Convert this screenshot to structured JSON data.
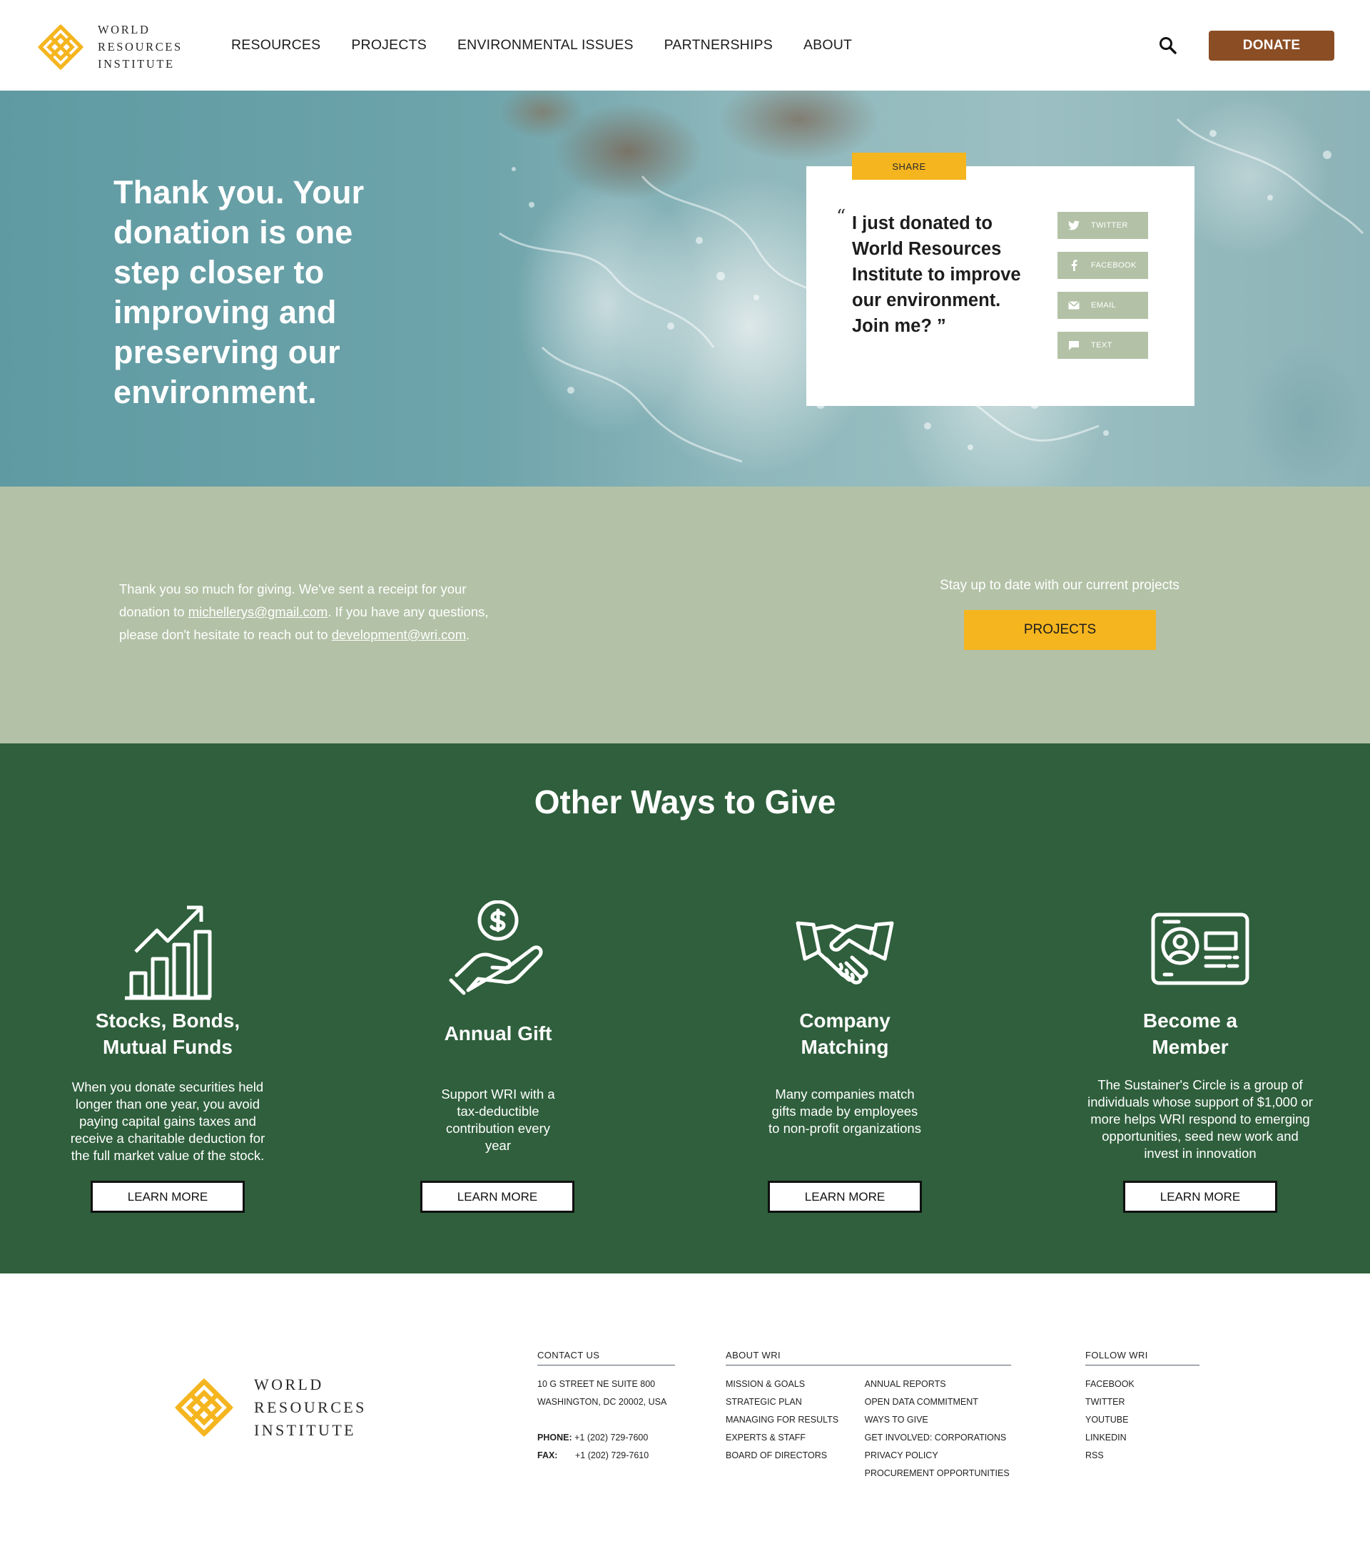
{
  "brand": {
    "line1": "World",
    "line2": "Resources",
    "line3": "Institute",
    "color_gold": "#f5b51f",
    "color_brown": "#8b4d24",
    "color_sage": "#b3c2a7",
    "color_green": "#2f5f3c"
  },
  "nav": {
    "items": [
      "RESOURCES",
      "PROJECTS",
      "ENVIRONMENTAL ISSUES",
      "PARTNERSHIPS",
      "ABOUT"
    ],
    "search_icon": "search-icon",
    "donate_label": "DONATE"
  },
  "hero": {
    "title": "Thank you. Your donation is one step closer to improving and preserving our environment.",
    "share_label": "SHARE",
    "quote": "I just donated to World Resources Institute to improve our environment. Join me?",
    "quote_open": "“",
    "quote_close": "”",
    "share_buttons": [
      {
        "label": "TWITTER",
        "icon": "twitter-icon"
      },
      {
        "label": "FACEBOOK",
        "icon": "facebook-icon"
      },
      {
        "label": "EMAIL",
        "icon": "email-icon"
      },
      {
        "label": "TEXT",
        "icon": "chat-bubble-icon"
      }
    ]
  },
  "receipt": {
    "text_before": "Thank you so much for giving. We've sent a receipt for your donation to ",
    "email": "michellerys@gmail.com",
    "text_middle": ". If you have any questions, please don't hesitate to reach out to ",
    "contact_email": "development@wri.com",
    "text_after": ".",
    "stay_text": "Stay up to date with our current projects",
    "projects_label": "PROJECTS"
  },
  "ways": {
    "title": "Other Ways to Give",
    "items": [
      {
        "icon": "growth-chart-icon",
        "title_line1": "Stocks, Bonds,",
        "title_line2": "Mutual Funds",
        "desc": "When you donate securities held longer than one year, you avoid paying capital gains taxes and receive a charitable deduction for the full market value of the stock.",
        "button": "LEARN MORE"
      },
      {
        "icon": "hand-coin-icon",
        "title_line1": "Annual Gift",
        "title_line2": "",
        "desc": "Support WRI with a tax-deductible contribution every year",
        "button": "LEARN MORE"
      },
      {
        "icon": "handshake-icon",
        "title_line1": "Company",
        "title_line2": "Matching",
        "desc": "Many companies match gifts made by employees to non-profit organizations",
        "button": "LEARN MORE"
      },
      {
        "icon": "member-card-icon",
        "title_line1": "Become a",
        "title_line2": "Member",
        "desc": "The Sustainer's Circle is a group of individuals whose support of $1,000 or more helps WRI respond to emerging opportunities, seed new work and invest in innovation",
        "button": "LEARN MORE"
      }
    ]
  },
  "footer": {
    "contact": {
      "heading": "CONTACT US",
      "address1": "10 G STREET NE SUITE 800",
      "address2": "WASHINGTON, DC 20002, USA",
      "phone_label": "PHONE:",
      "phone": "+1 (202) 729-7600",
      "fax_label": "FAX:",
      "fax": "+1 (202) 729-7610"
    },
    "about": {
      "heading": "ABOUT WRI",
      "col1": [
        "MISSION & GOALS",
        "STRATEGIC PLAN",
        "MANAGING FOR RESULTS",
        "EXPERTS & STAFF",
        "BOARD OF DIRECTORS"
      ],
      "col2": [
        "ANNUAL REPORTS",
        "OPEN DATA COMMITMENT",
        "WAYS TO GIVE",
        "GET INVOLVED: CORPORATIONS",
        "PRIVACY POLICY",
        "PROCUREMENT OPPORTUNITIES"
      ]
    },
    "follow": {
      "heading": "FOLLOW WRI",
      "items": [
        "FACEBOOK",
        "TWITTER",
        "YOUTUBE",
        "LINKEDIN",
        "RSS"
      ]
    }
  }
}
